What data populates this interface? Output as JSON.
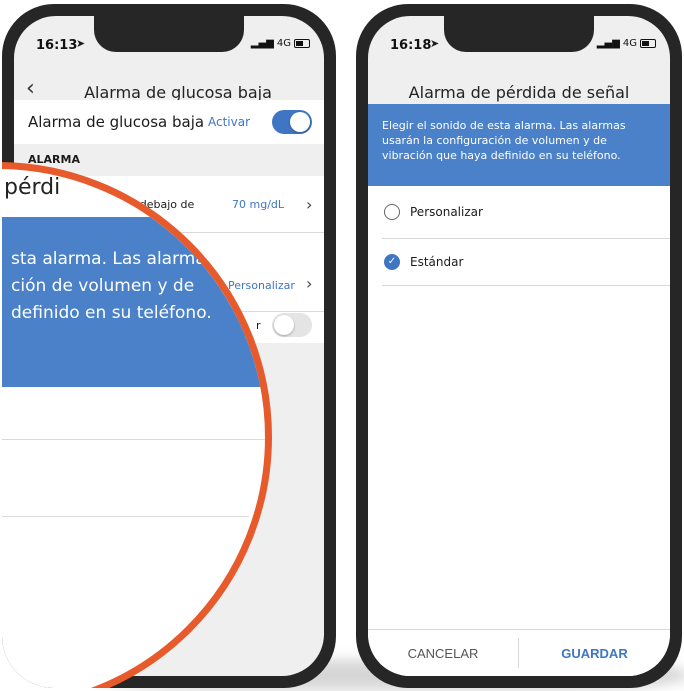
{
  "left_phone": {
    "status": {
      "time": "16:13",
      "network": "4G"
    },
    "header": {
      "back_icon": "chevron-left-icon",
      "title": "Alarma de glucosa baja"
    },
    "main_toggle": {
      "label": "Alarma de glucosa baja",
      "action": "Activar",
      "on": true
    },
    "section_header": "ALARMA",
    "threshold_row": {
      "label": "por debajo de",
      "value": "70 mg/dL"
    },
    "sound_row": {
      "value": "Personalizar"
    },
    "vibration_row": {
      "label": "r",
      "on": false
    },
    "magnifier": {
      "title_fragment": "pérdi",
      "banner_lines": [
        "sta alarma. Las alarma",
        "ción de volumen y de",
        "definido en su teléfono."
      ]
    }
  },
  "right_phone": {
    "status": {
      "time": "16:18",
      "network": "4G"
    },
    "header": {
      "title": "Alarma de pérdida de señal"
    },
    "banner_text": "Elegir el sonido de esta alarma. Las alarmas usarán la configuración de volumen y de vibración que haya definido en su teléfono.",
    "options": [
      {
        "label": "Personalizar",
        "selected": false
      },
      {
        "label": "Estándar",
        "selected": true
      }
    ],
    "footer": {
      "cancel": "CANCELAR",
      "save": "GUARDAR"
    }
  },
  "colors": {
    "accent": "#4a81c8",
    "highlight": "#e65a2c",
    "text_blue": "#3f76c4"
  }
}
